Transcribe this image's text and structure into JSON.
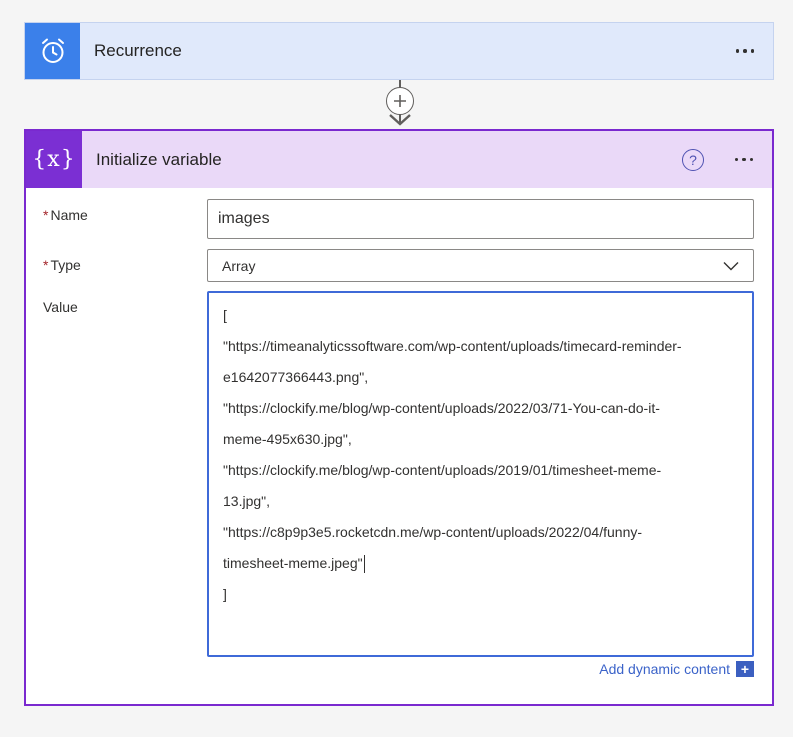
{
  "recurrence": {
    "title": "Recurrence",
    "icon": "alarm-clock-icon",
    "accent": "#3b80ea"
  },
  "connector": {
    "add_icon": "plus-icon"
  },
  "init_variable": {
    "title": "Initialize variable",
    "icon_symbol": "{x}",
    "help_glyph": "?",
    "accent": "#7b2fd3",
    "fields": {
      "name_label": "Name",
      "name_value": "images",
      "type_label": "Type",
      "type_value": "Array",
      "value_label": "Value",
      "value_lines": [
        "[",
        "\"https://timeanalyticssoftware.com/wp-content/uploads/timecard-reminder-",
        "e1642077366443.png\",",
        "\"https://clockify.me/blog/wp-content/uploads/2022/03/71-You-can-do-it-",
        "meme-495x630.jpg\",",
        "\"https://clockify.me/blog/wp-content/uploads/2019/01/timesheet-meme-",
        "13.jpg\",",
        "\"https://c8p9p3e5.rocketcdn.me/wp-content/uploads/2022/04/funny-",
        "timesheet-meme.jpeg\"",
        "]"
      ]
    },
    "dynamic_content_label": "Add dynamic content"
  }
}
